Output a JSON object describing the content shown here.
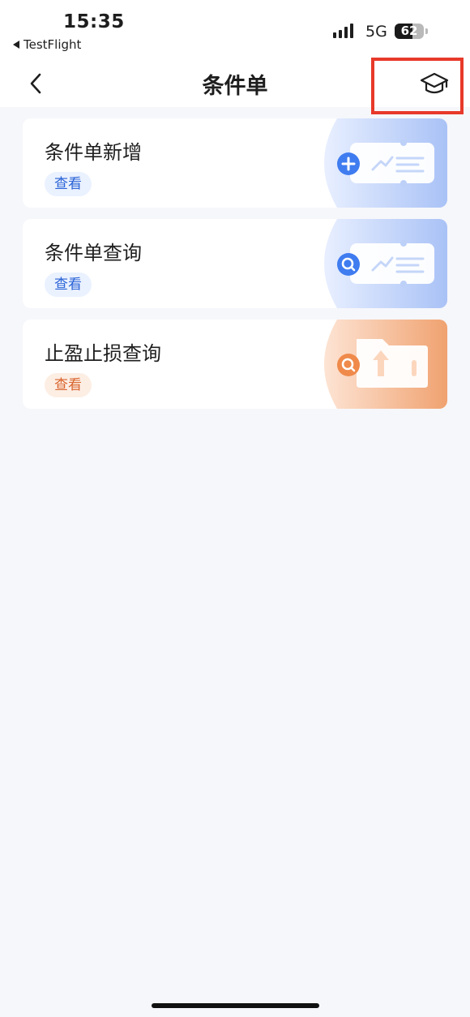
{
  "status_bar": {
    "time": "15:35",
    "back_app": "TestFlight",
    "network": "5G",
    "battery": "62",
    "battery_level": 0.62
  },
  "nav": {
    "title": "条件单",
    "back_icon": "chevron-left-icon",
    "learn_icon": "graduation-cap-icon",
    "highlight_color": "#e8392a"
  },
  "cards": [
    {
      "title": "条件单新增",
      "tag": "查看",
      "theme": "blue",
      "icon": "add-icon"
    },
    {
      "title": "条件单查询",
      "tag": "查看",
      "theme": "blue",
      "icon": "search-icon"
    },
    {
      "title": "止盈止损查询",
      "tag": "查看",
      "theme": "orange",
      "icon": "search-icon"
    }
  ],
  "colors": {
    "blue_accent": "#3f7cf0",
    "orange_accent": "#ef8a4b",
    "background": "#f6f7fb"
  }
}
